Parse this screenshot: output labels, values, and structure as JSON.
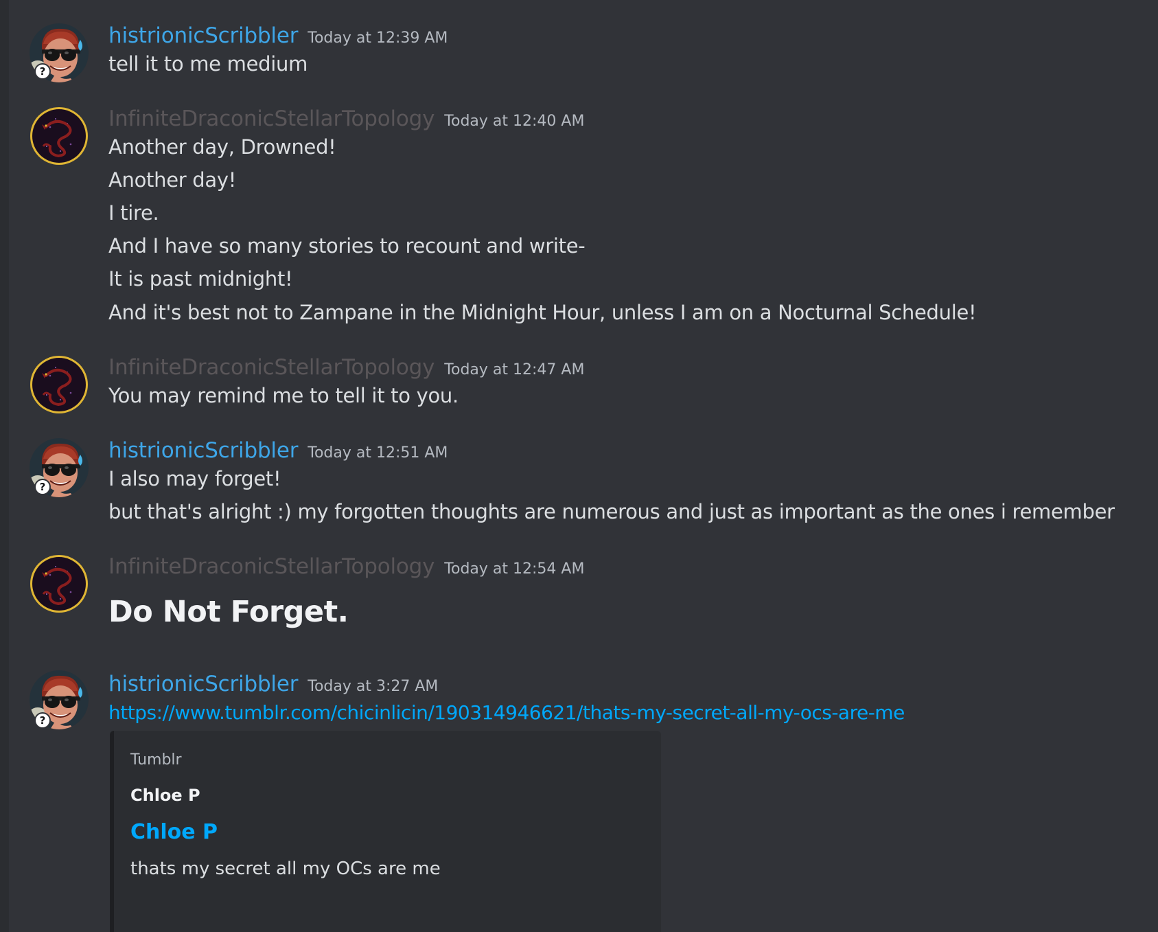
{
  "colors": {
    "background": "#313338",
    "scribbler_name": "#3ea6e8",
    "topology_name": "#5a5659",
    "text": "#dbdee1",
    "timestamp": "#b5bac1",
    "link": "#00a8fc",
    "embed_bg": "#2b2d31"
  },
  "messages": [
    {
      "author": "histrionicScribbler",
      "timestamp": "Today at 12:39 AM",
      "avatar_icon": "sunglasses-character-avatar",
      "badge": "?",
      "lines": [
        "tell it to me medium"
      ]
    },
    {
      "author": "InfiniteDraconicStellarTopology",
      "timestamp": "Today at 12:40 AM",
      "avatar_icon": "dragon-avatar",
      "lines": [
        "Another day, Drowned!",
        "Another day!",
        "I tire.",
        "And I have so many stories to recount and write-",
        "It is past midnight!",
        "And it's best not to Zampane in the Midnight Hour, unless I am on a Nocturnal Schedule!"
      ]
    },
    {
      "author": "InfiniteDraconicStellarTopology",
      "timestamp": "Today at 12:47 AM",
      "avatar_icon": "dragon-avatar",
      "lines": [
        "You may remind me to tell it to you."
      ]
    },
    {
      "author": "histrionicScribbler",
      "timestamp": "Today at 12:51 AM",
      "avatar_icon": "sunglasses-character-avatar",
      "badge": "?",
      "lines": [
        "I also may forget!",
        "but that's alright :) my forgotten thoughts are numerous and just as important as the ones i remember"
      ]
    },
    {
      "author": "InfiniteDraconicStellarTopology",
      "timestamp": "Today at 12:54 AM",
      "avatar_icon": "dragon-avatar",
      "lines": [
        "Do Not Forget."
      ]
    },
    {
      "author": "histrionicScribbler",
      "timestamp": "Today at 3:27 AM",
      "avatar_icon": "sunglasses-character-avatar",
      "badge": "?",
      "link": "https://www.tumblr.com/chicinlicin/190314946621/thats-my-secret-all-my-ocs-are-me",
      "embed": {
        "provider": "Tumblr",
        "author": "Chloe P",
        "title": "Chloe P",
        "description": "thats my secret all my OCs are me"
      }
    }
  ]
}
